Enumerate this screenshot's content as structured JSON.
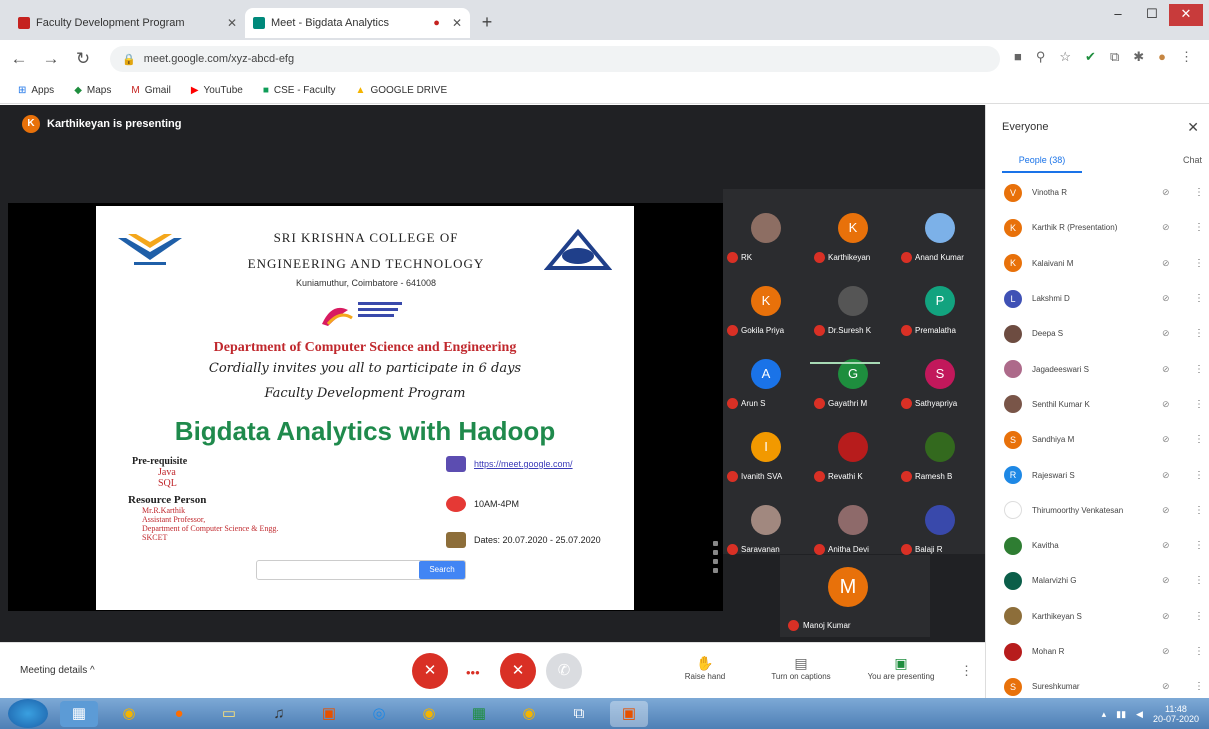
{
  "browser": {
    "tabs": [
      {
        "label": "Faculty Development Program",
        "favicon_color": "#c5221f",
        "active": false
      },
      {
        "label": "Meet - Bigdata Analytics",
        "favicon_color": "#00897b",
        "active": true
      }
    ],
    "newtab_label": "+",
    "window_controls": [
      "–",
      "☐",
      "✕"
    ],
    "url": "meet.google.com/xyz-abcd-efg",
    "bookmarks": [
      "Apps",
      "Maps",
      "Gmail",
      "YouTube",
      "CSE - Faculty",
      "GOOGLE DRIVE"
    ]
  },
  "meet": {
    "presenter_label": "Karthikeyan is presenting",
    "presenter_initial": "K",
    "slide": {
      "college_line1": "SRI KRISHNA COLLEGE OF",
      "college_line2": "ENGINEERING AND TECHNOLOGY",
      "college_line3": "Kuniamuthur, Coimbatore - 641008",
      "department": "Department of Computer Science and Engineering",
      "invite": "Cordially invites you all to participate in 6 days",
      "program": "Faculty Development Program",
      "title": "Bigdata Analytics with Hadoop",
      "prereq_heading": "Pre-requisite",
      "prereq_items": [
        "Java",
        "SQL"
      ],
      "resource_heading": "Resource Person",
      "resource_items": [
        "Mr.R.Karthik",
        "Assistant Professor,",
        "Department of Computer Science & Engg.",
        "SKCET"
      ],
      "info_link": "https://meet.google.com/",
      "info_time": "10AM-4PM",
      "info_dates": "Dates: 20.07.2020 - 25.07.2020",
      "search_placeholder": "",
      "search_button": "Search"
    },
    "participants_grid": [
      {
        "label": "RK",
        "initial": "",
        "color": "#8d6e63"
      },
      {
        "label": "Karthikeyan",
        "initial": "K",
        "color": "#e8710a"
      },
      {
        "label": "Anand Kumar",
        "initial": "",
        "color": "#7cb1e8"
      },
      {
        "label": "Gokila Priya",
        "initial": "K",
        "color": "#e8710a"
      },
      {
        "label": "Dr.Suresh K",
        "initial": "",
        "color": "#555"
      },
      {
        "label": "Premalatha",
        "initial": "P",
        "color": "#12a37f"
      },
      {
        "label": "Arun S",
        "initial": "A",
        "color": "#1a73e8"
      },
      {
        "label": "Gayathri M",
        "initial": "G",
        "color": "#1e8e3e"
      },
      {
        "label": "Sathyapriya",
        "initial": "S",
        "color": "#c2185b"
      },
      {
        "label": "Ivanith SVA",
        "initial": "I",
        "color": "#f29900"
      },
      {
        "label": "Revathi K",
        "initial": "",
        "color": "#b71c1c"
      },
      {
        "label": "Ramesh B",
        "initial": "",
        "color": "#33691e"
      },
      {
        "label": "Saravanan",
        "initial": "",
        "color": "#a1887f"
      },
      {
        "label": "Anitha Devi",
        "initial": "",
        "color": "#8e6a6a"
      },
      {
        "label": "Balaji R",
        "initial": "",
        "color": "#3949ab"
      }
    ],
    "self_tile": {
      "initial": "M",
      "label": "Manoj Kumar"
    },
    "meeting_details": "Meeting details ^",
    "actions": [
      {
        "icon": "✋",
        "label": "Raise hand"
      },
      {
        "icon": "▤",
        "label": "Turn on captions"
      },
      {
        "icon": "▣",
        "label": "You are presenting"
      }
    ]
  },
  "panel": {
    "title": "Everyone",
    "tabs": [
      "People (38)",
      "Chat"
    ],
    "people": [
      {
        "name": "Vinotha R",
        "initial": "V",
        "color": "#e8710a"
      },
      {
        "name": "Karthik R (Presentation)",
        "initial": "K",
        "color": "#e8710a"
      },
      {
        "name": "Kalaivani M",
        "initial": "K",
        "color": "#e8710a"
      },
      {
        "name": "Lakshmi D",
        "initial": "L",
        "color": "#3f51b5"
      },
      {
        "name": "Deepa S",
        "initial": "",
        "color": "#6d4c41"
      },
      {
        "name": "Jagadeeswari S",
        "initial": "",
        "color": "#ad6a8a"
      },
      {
        "name": "Senthil Kumar K",
        "initial": "",
        "color": "#795548"
      },
      {
        "name": "Sandhiya M",
        "initial": "S",
        "color": "#e8710a"
      },
      {
        "name": "Rajeswari S",
        "initial": "R",
        "color": "#1e88e5"
      },
      {
        "name": "Thirumoorthy Venkatesan",
        "initial": "",
        "color": "#ffffff"
      },
      {
        "name": "Kavitha",
        "initial": "",
        "color": "#2e7d32"
      },
      {
        "name": "Malarvizhi G",
        "initial": "",
        "color": "#0b5e49"
      },
      {
        "name": "Karthikeyan S",
        "initial": "",
        "color": "#8d6e3a"
      },
      {
        "name": "Mohan R",
        "initial": "",
        "color": "#b71c1c"
      },
      {
        "name": "Sureshkumar",
        "initial": "S",
        "color": "#e8710a"
      }
    ]
  },
  "taskbar": {
    "clock_time": "11:48",
    "clock_date": "20-07-2020"
  },
  "colors": {
    "meet_bg": "#202124",
    "mic_off": "#d93025",
    "accent_blue": "#1a73e8",
    "title_green": "#1f8a4c",
    "dept_red": "#c0282d"
  }
}
